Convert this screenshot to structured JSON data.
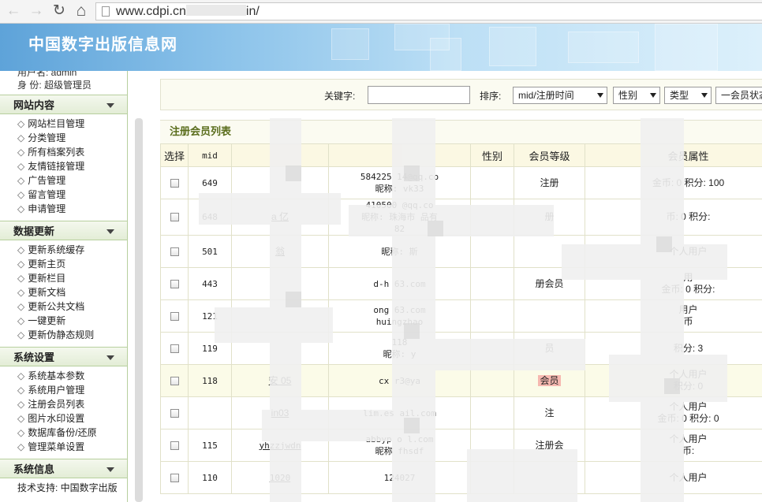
{
  "browser": {
    "back_icon": "←",
    "forward_icon": "→",
    "reload_icon": "↻",
    "home_icon": "⌂",
    "url_prefix": "www.cdpi.cn",
    "url_suffix": "in/"
  },
  "header": {
    "site_title": "中国数字出版信息网"
  },
  "sidebar": {
    "user_line": "用户名: admin",
    "role_line": "身  份: 超级管理员",
    "groups": [
      {
        "title": "网站内容",
        "items": [
          "网站栏目管理",
          "分类管理",
          "所有档案列表",
          "友情链接管理",
          "广告管理",
          "留言管理",
          "申请管理"
        ]
      },
      {
        "title": "数据更新",
        "items": [
          "更新系统缓存",
          "更新主页",
          "更新栏目",
          "更新文档",
          "更新公共文档",
          "一键更新",
          "更新伪静态规则"
        ]
      },
      {
        "title": "系统设置",
        "items": [
          "系统基本参数",
          "系统用户管理",
          "注册会员列表",
          "图片水印设置",
          "数据库备份/还原",
          "管理菜单设置"
        ]
      },
      {
        "title": "系统信息",
        "items": []
      }
    ],
    "support_text": "技术支持: 中国数字出版"
  },
  "filters": {
    "keyword_label": "关键字:",
    "keyword_value": "",
    "sort_label": "排序:",
    "sort_value": "mid/注册时间",
    "gender_value": "性别",
    "type_value": "类型",
    "member_value": "一会员状态"
  },
  "list": {
    "title": "注册会员列表",
    "columns": [
      "选择",
      "mid",
      "",
      "",
      "性别",
      "会员等级",
      "会员属性"
    ],
    "rows": [
      {
        "mid": "649",
        "username": "",
        "email": "584225   14@qq.co",
        "nickname": "昵称: vk33",
        "gender": "",
        "level": "注册",
        "attr1": "",
        "attr2": "金币: 0 积分: 100"
      },
      {
        "mid": "648",
        "username": "a   亿",
        "email": "410500   @qq.co",
        "nickname": "昵称: 珠海市     品有",
        "nickname2": "     82",
        "gender": "",
        "level": "册",
        "attr1": "",
        "attr2": "币: 0 积分:"
      },
      {
        "mid": "501",
        "username": "翁",
        "email": "",
        "nickname": "昵称:     斯",
        "gender": "",
        "level": "",
        "attr1": "个人用户",
        "attr2": ""
      },
      {
        "mid": "443",
        "username": "",
        "email": "      d-h    63.com",
        "nickname": "",
        "gender": "",
        "level": "册会员",
        "attr1": "用",
        "attr2": "金币: 0 积分:"
      },
      {
        "mid": "121",
        "username": "",
        "email": "      ong     63.com",
        "nickname": "      huingzhao",
        "gender": "",
        "level": "",
        "attr1": "用户",
        "attr2": "币"
      },
      {
        "mid": "119",
        "username": "",
        "email": "118",
        "nickname": "昵称:     y",
        "gender": "",
        "level": "员",
        "attr1": "",
        "attr2": "积分:   3"
      },
      {
        "mid": "118",
        "username": "安   05",
        "email": "cx    r3@ya",
        "nickname": "",
        "gender": "",
        "level": "会员",
        "attr1": "个人用户",
        "attr2": "积分:   0"
      },
      {
        "mid": "",
        "username": "    in03",
        "email": "lim.es      ail.com",
        "nickname": "",
        "gender": "",
        "level": "注",
        "attr1": "个人用户",
        "attr2": "金币: 0 积分:   0"
      },
      {
        "mid": "115",
        "username": "yhzzjwdn",
        "email": "abbyp     o     l.com",
        "nickname": "昵称     fhsdf",
        "gender": "",
        "level": "注册会",
        "attr1": "个人用户",
        "attr2": "币:"
      },
      {
        "mid": "110",
        "username": "    1020",
        "email": "124027",
        "nickname": "",
        "gender": "",
        "level": "",
        "attr1": "个人用户",
        "attr2": ""
      }
    ]
  }
}
